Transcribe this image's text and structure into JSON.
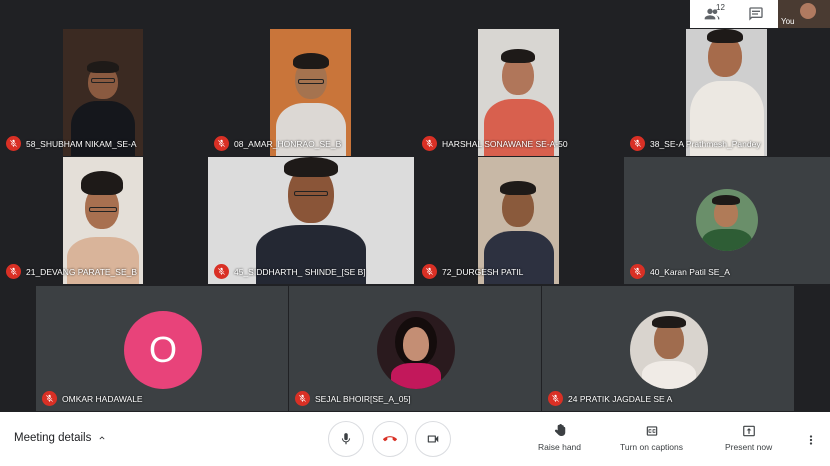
{
  "topbar": {
    "people_count": "12",
    "self_label": "You"
  },
  "participants": [
    {
      "name": "58_SHUBHAM NIKAM_SE-A"
    },
    {
      "name": "08_AMAR_HONRAO_SE_B"
    },
    {
      "name": "HARSHAL SONAWANE SE-A-50"
    },
    {
      "name": "38_SE-A Prathmesh_Pandey"
    },
    {
      "name": "21_DEVANG PARATE_SE_B"
    },
    {
      "name": "45_SIDDHARTH_ SHINDE_[SE B]"
    },
    {
      "name": "72_DURGESH PATIL"
    },
    {
      "name": "40_Karan Patil SE_A"
    },
    {
      "name": "OMKAR HADAWALE",
      "initial": "O",
      "avatar_color": "#e8437a"
    },
    {
      "name": "SEJAL BHOIR[SE_A_05]"
    },
    {
      "name": "24 PRATIK JAGDALE SE A"
    }
  ],
  "bottombar": {
    "meeting_details": "Meeting details",
    "raise_hand": "Raise hand",
    "captions": "Turn on captions",
    "present": "Present now"
  },
  "colors": {
    "background": "#202124",
    "mic_off": "#d93025",
    "hangup": "#d93025"
  }
}
